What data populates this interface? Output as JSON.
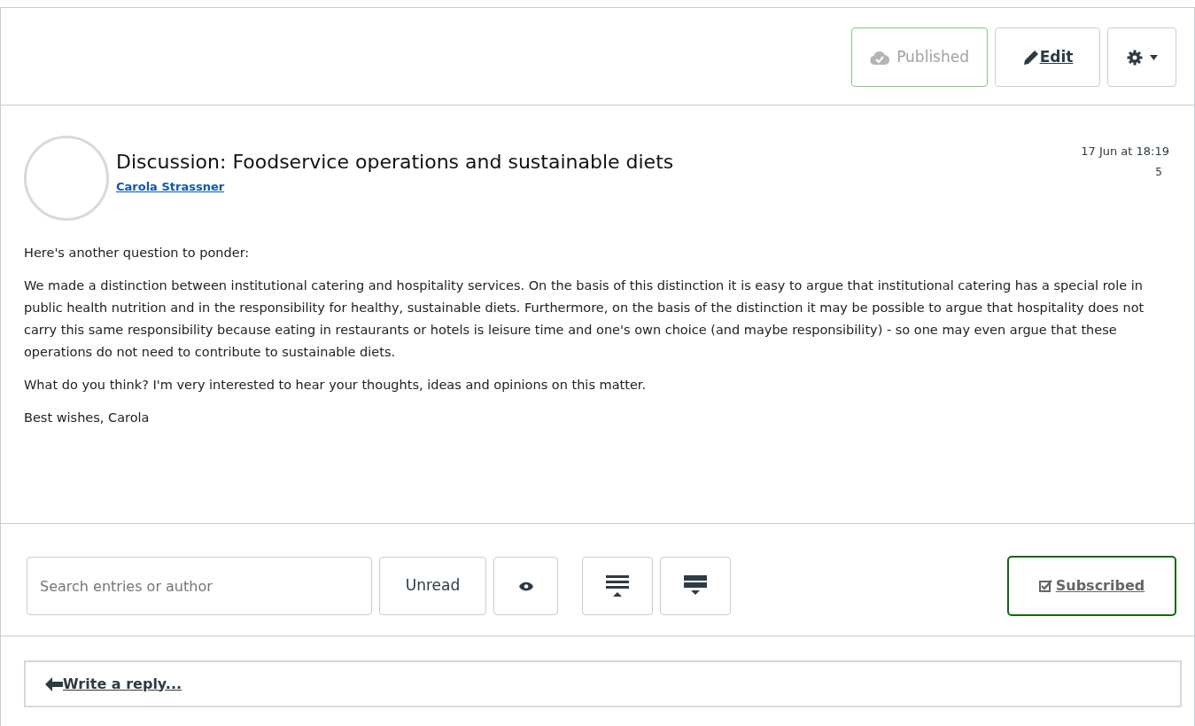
{
  "toolbar": {
    "published_label": "Published",
    "published": true,
    "edit_label": "Edit"
  },
  "topic": {
    "title": "Discussion: Foodservice operations and sustainable diets",
    "author": "Carola Strassner",
    "date": "17 Jun at 18:19",
    "count": "5",
    "paragraphs": [
      "Here's another question to ponder:",
      "We made a distinction between institutional catering and hospitality services. On the basis of this distinction it is easy to argue that institutional catering has a special role in public health nutrition and in the responsibility for healthy, sustainable diets. Furthermore, on the basis of the distinction it may be possible to argue that hospitality does not carry this same responsibility because eating in restaurants or hotels is leisure time and one's own choice (and maybe responsibility) - so one may even argue that these operations do not need to contribute to sustainable diets.",
      "What do you think? I'm very interested to hear your thoughts, ideas and opinions on this matter.",
      "Best wishes, Carola"
    ]
  },
  "filters": {
    "search": {
      "placeholder": "Search entries or author"
    },
    "unread_label": "Unread",
    "subscribed_label": "Subscribed",
    "subscribed": true
  },
  "reply": {
    "label": "Write a reply..."
  }
}
